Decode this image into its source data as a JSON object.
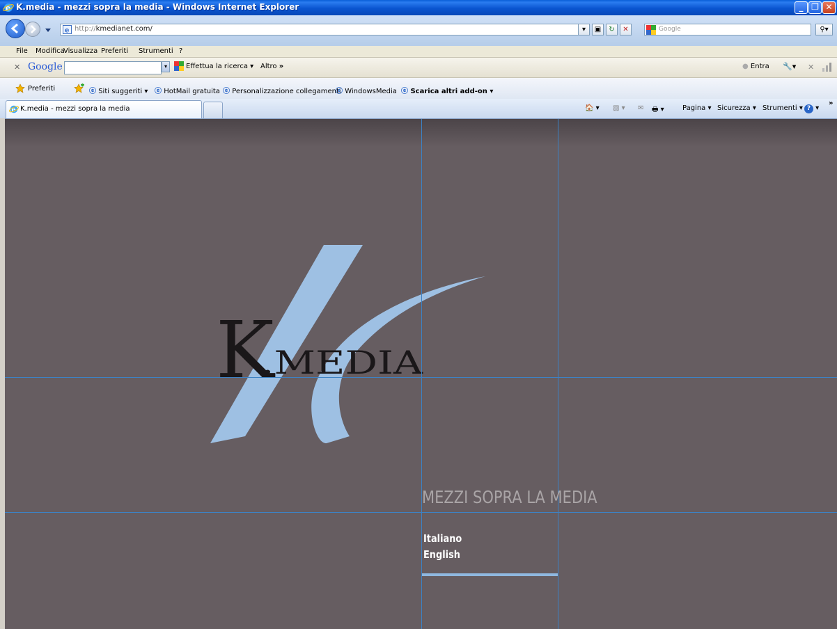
{
  "window": {
    "title": "K.media - mezzi sopra la media - Windows Internet Explorer"
  },
  "addressbar": {
    "url_scheme": "http://",
    "url_host": "kmedianet.com/",
    "search_placeholder": "Google"
  },
  "menu": [
    "File",
    "Modifica",
    "Visualizza",
    "Preferiti",
    "Strumenti",
    "?"
  ],
  "google_toolbar": {
    "logo": "Google",
    "search_button": "Effettua la ricerca",
    "more": "Altro",
    "signin": "Entra"
  },
  "favorites": {
    "label": "Preferiti",
    "items": [
      "Siti suggeriti",
      "HotMail gratuita",
      "Personalizzazione collegamenti",
      "WindowsMedia",
      "Scarica altri add-on"
    ]
  },
  "tabs": {
    "active": "K.media - mezzi sopra la media"
  },
  "command_bar": {
    "pagina": "Pagina",
    "sicurezza": "Sicurezza",
    "strumenti": "Strumenti"
  },
  "page": {
    "logo_k": "K",
    "logo_media": ".MEDIA",
    "tagline": "MEZZI SOPRA LA MEDIA",
    "languages": [
      "Italiano",
      "English"
    ]
  },
  "colors": {
    "background": "#665d61",
    "accent": "#9ec0e3",
    "guides": "#3d82c4"
  }
}
